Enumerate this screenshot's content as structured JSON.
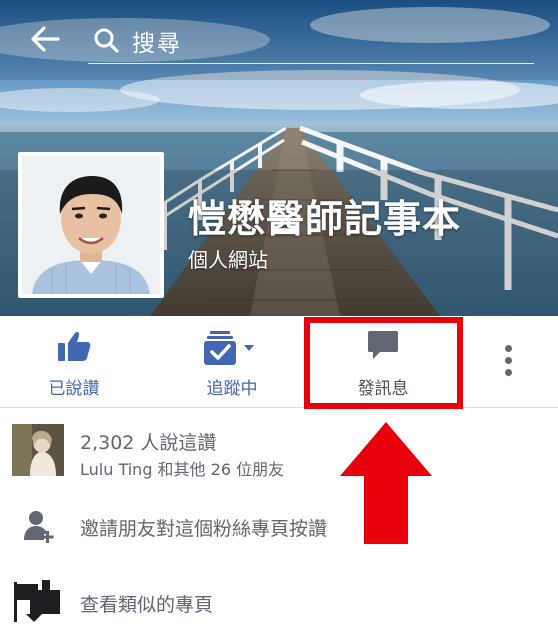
{
  "header": {
    "search_placeholder": "搜尋",
    "back_icon": "arrow-left-icon",
    "search_icon": "search-icon"
  },
  "profile": {
    "title": "愷懋醫師記事本",
    "category": "個人網站"
  },
  "actions": {
    "like": {
      "label": "已說讚",
      "icon": "thumbs-up-icon"
    },
    "follow": {
      "label": "追蹤中",
      "icon": "following-icon"
    },
    "message": {
      "label": "發訊息",
      "icon": "chat-bubble-icon"
    },
    "more_icon": "vertical-dots-icon"
  },
  "likes": {
    "count_text": "2,302 人說這讚",
    "friends_text": "Lulu Ting 和其他 26 位朋友"
  },
  "invite": {
    "text": "邀請朋友對這個粉絲專頁按讚",
    "icon": "add-person-icon"
  },
  "similar": {
    "text": "查看類似的專頁",
    "icon": "similar-pages-icon"
  },
  "colors": {
    "facebook_blue": "#4267b2",
    "highlight_red": "#e8000b",
    "text_gray": "#606770"
  }
}
